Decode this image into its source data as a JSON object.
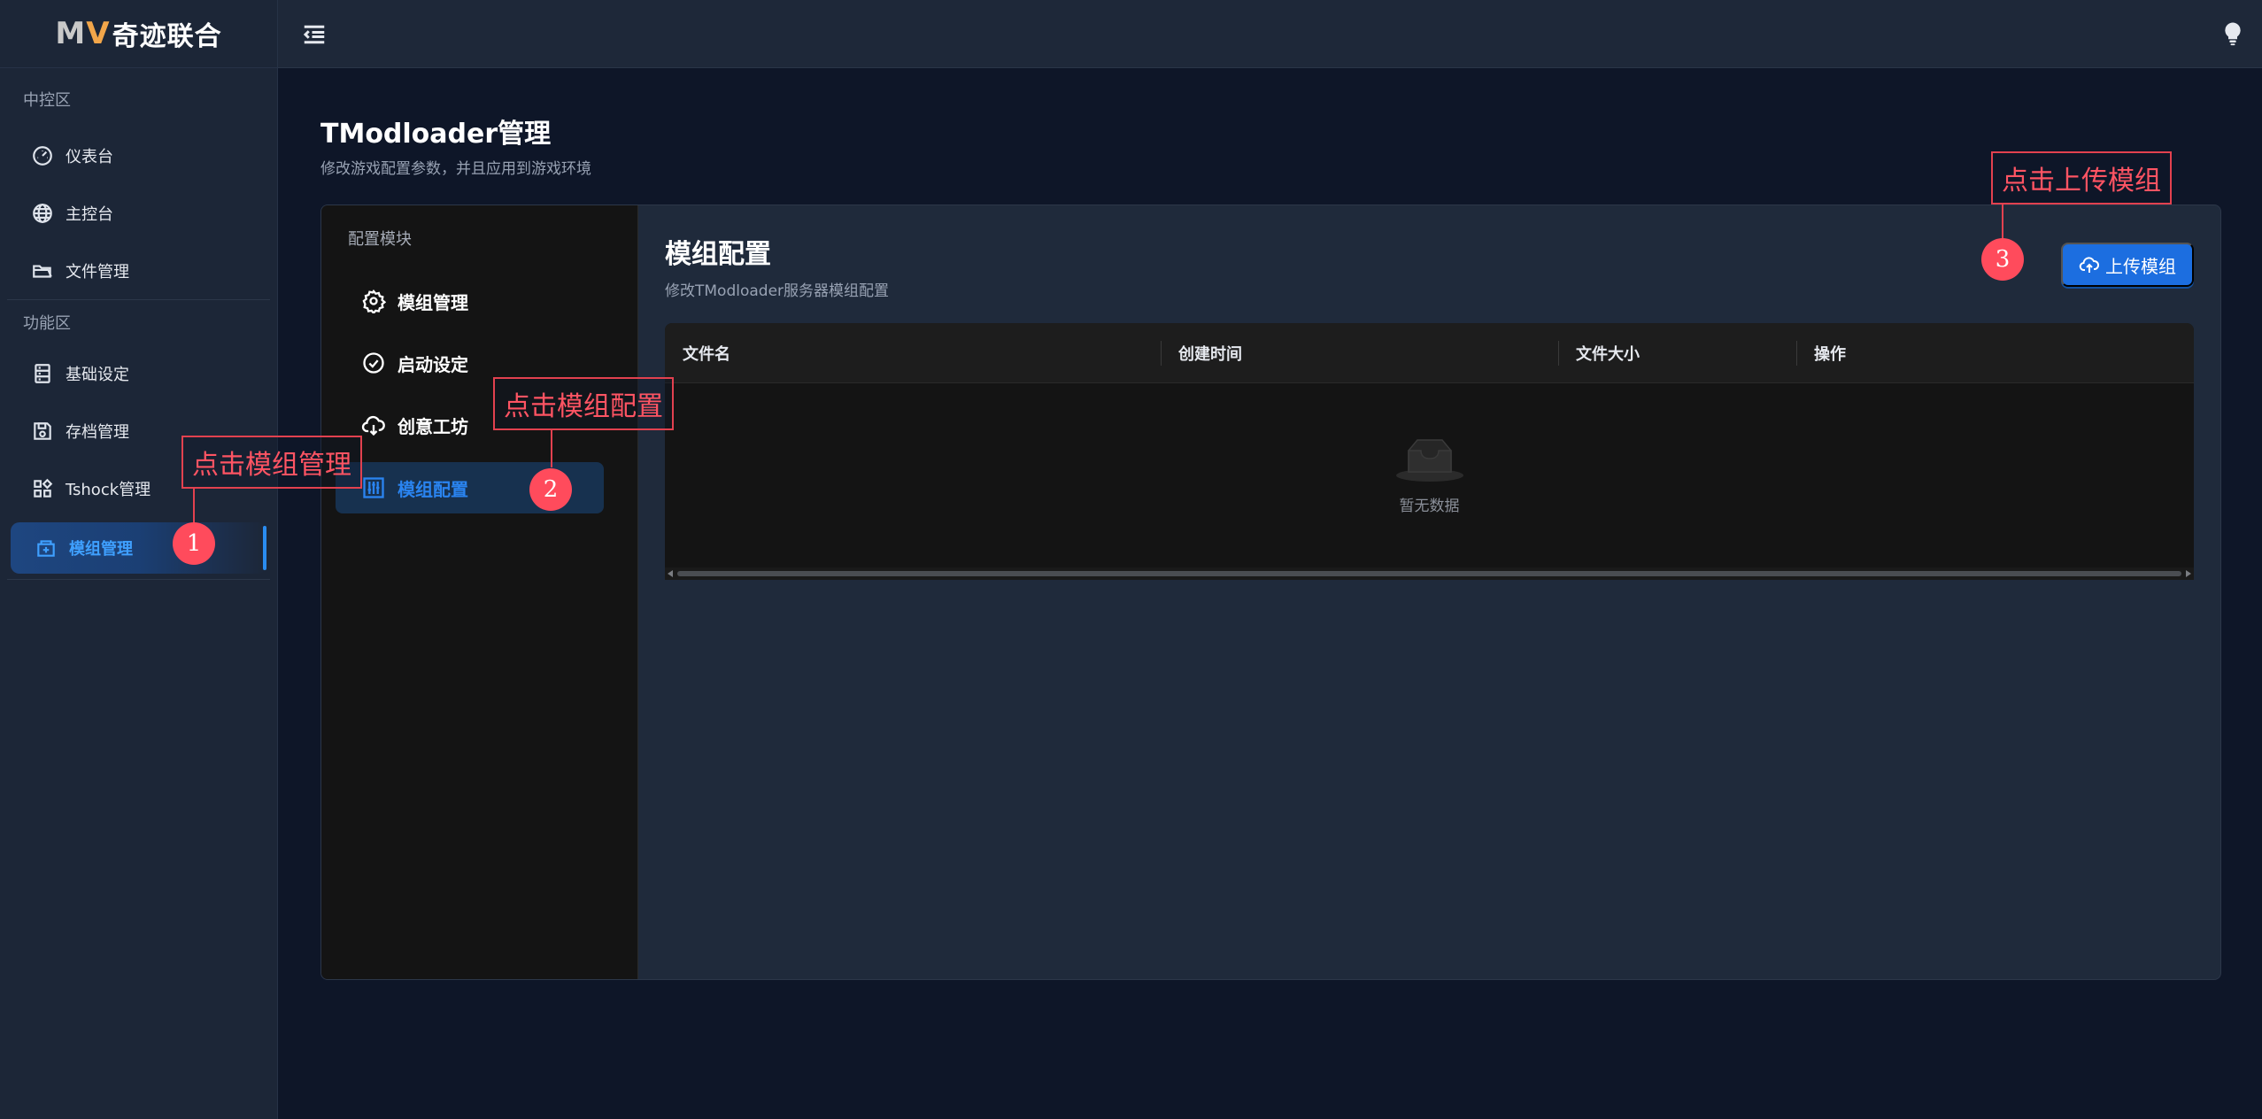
{
  "app": {
    "logo_mark_m": "M",
    "logo_mark_v": "V",
    "logo_text": "奇迹联合"
  },
  "sidebar": {
    "sections": [
      {
        "title": "中控区",
        "items": [
          {
            "label": "仪表台",
            "icon": "dashboard-icon"
          },
          {
            "label": "主控台",
            "icon": "globe-icon"
          },
          {
            "label": "文件管理",
            "icon": "folder-icon"
          }
        ]
      },
      {
        "title": "功能区",
        "items": [
          {
            "label": "基础设定",
            "icon": "server-icon"
          },
          {
            "label": "存档管理",
            "icon": "save-icon"
          },
          {
            "label": "Tshock管理",
            "icon": "apps-icon"
          },
          {
            "label": "模组管理",
            "icon": "module-icon",
            "active": true
          }
        ]
      }
    ]
  },
  "page": {
    "title": "TModloader管理",
    "subtitle": "修改游戏配置参数，并且应用到游戏环境"
  },
  "module_menu": {
    "title": "配置模块",
    "items": [
      {
        "label": "模组管理",
        "icon": "gear-icon"
      },
      {
        "label": "启动设定",
        "icon": "check-circle-icon"
      },
      {
        "label": "创意工坊",
        "icon": "cloud-download-icon"
      },
      {
        "label": "模组配置",
        "icon": "sliders-icon",
        "active": true
      }
    ]
  },
  "content": {
    "title": "模组配置",
    "subtitle": "修改TModloader服务器模组配置",
    "upload_label": "上传模组",
    "table": {
      "columns": [
        "文件名",
        "创建时间",
        "文件大小",
        "操作"
      ],
      "rows": [],
      "empty_text": "暂无数据"
    }
  },
  "annotations": [
    {
      "number": "1",
      "text": "点击模组管理"
    },
    {
      "number": "2",
      "text": "点击模组配置"
    },
    {
      "number": "3",
      "text": "点击上传模组"
    }
  ],
  "colors": {
    "accent": "#1c6ee0",
    "active_text": "#2a84f0",
    "annotation": "#ff4b5c"
  }
}
